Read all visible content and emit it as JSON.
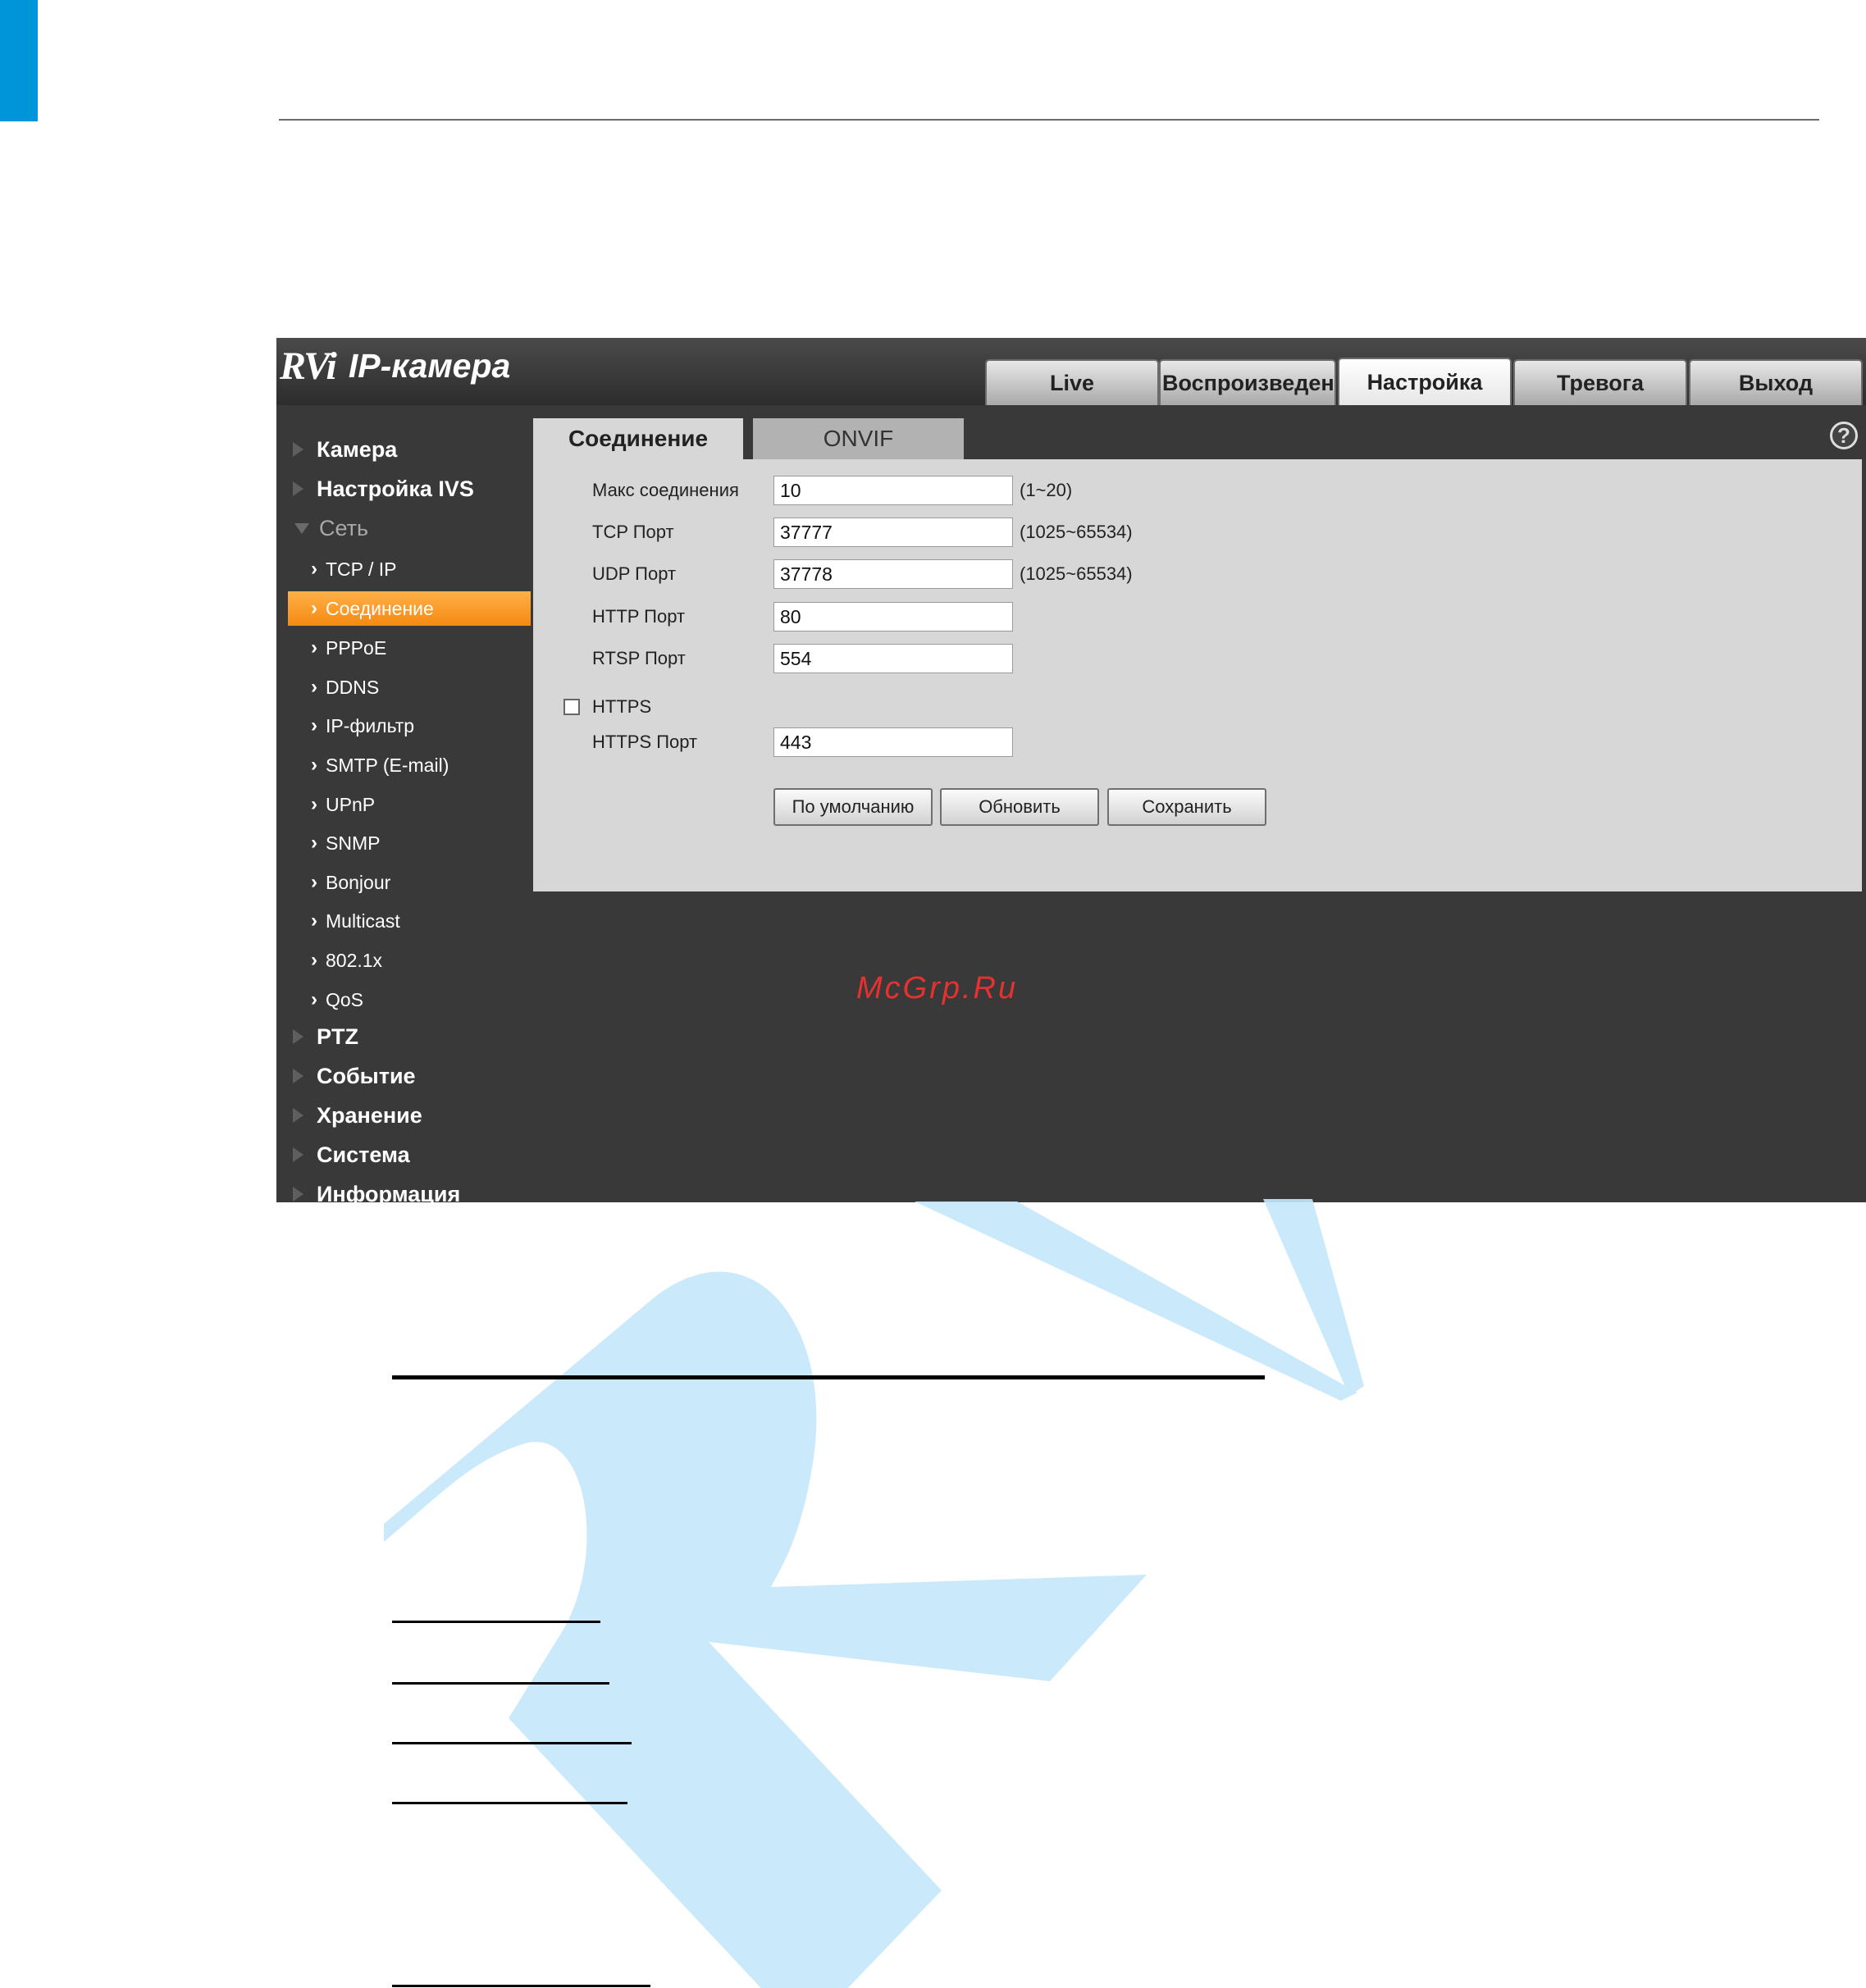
{
  "app": {
    "logo_brand": "RVi",
    "title": "IP-камера"
  },
  "nav_tabs": [
    {
      "label": "Live"
    },
    {
      "label": "Воспроизведение"
    },
    {
      "label": "Настройка",
      "active": true
    },
    {
      "label": "Тревога"
    },
    {
      "label": "Выход"
    }
  ],
  "sidebar": {
    "top_groups": [
      "Камера",
      "Настройка IVS"
    ],
    "network_group": "Сеть",
    "network_items": [
      "TCP / IP",
      "Соединение",
      "PPPoE",
      "DDNS",
      "IP-фильтр",
      "SMTP (E-mail)",
      "UPnP",
      "SNMP",
      "Bonjour",
      "Multicast",
      "802.1x",
      "QoS"
    ],
    "active_item": "Соединение",
    "bottom_groups": [
      "PTZ",
      "Событие",
      "Хранение",
      "Система",
      "Информация"
    ]
  },
  "subtabs": {
    "connection": "Соединение",
    "onvif": "ONVIF",
    "help_symbol": "?"
  },
  "form": {
    "max_connections": {
      "label": "Макс соединения",
      "value": "10",
      "range": "(1~20)"
    },
    "tcp_port": {
      "label": "TCP Порт",
      "value": "37777",
      "range": "(1025~65534)"
    },
    "udp_port": {
      "label": "UDP Порт",
      "value": "37778",
      "range": "(1025~65534)"
    },
    "http_port": {
      "label": "HTTP Порт",
      "value": "80"
    },
    "rtsp_port": {
      "label": "RTSP Порт",
      "value": "554"
    },
    "https": {
      "label": "HTTPS",
      "checked": false
    },
    "https_port": {
      "label": "HTTPS Порт",
      "value": "443"
    }
  },
  "buttons": {
    "default": "По умолчанию",
    "refresh": "Обновить",
    "save": "Сохранить"
  },
  "watermark_text": "McGrp.Ru",
  "colors": {
    "accent_blue": "#0095d9",
    "active_orange": "#f7941d",
    "watermark_blue": "#c6e9fb",
    "watermark_red": "#e5312f"
  }
}
